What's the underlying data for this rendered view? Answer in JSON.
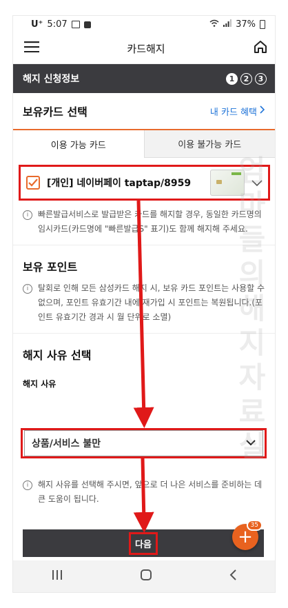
{
  "status_bar": {
    "carrier": "U⁺",
    "time": "5:07",
    "battery": "37%"
  },
  "app_bar": {
    "title": "카드해지"
  },
  "progress": {
    "title": "해지 신청정보",
    "steps": [
      "1",
      "2",
      "3"
    ],
    "current_step": 1
  },
  "card_section": {
    "title": "보유카드 선택",
    "benefit_link": "내 카드 혜택",
    "tabs": [
      "이용 가능 카드",
      "이용 불가능 카드"
    ],
    "selected_card": "[개인] 네이버페이 taptap/8959",
    "notice": "빠른발급서비스로 발급받은 카드를 해지할 경우, 동일한 카드명의 임시카드(카드명에 \"빠른발급S\" 표기)도 함께 해지해 주세요."
  },
  "points_section": {
    "title": "보유 포인트",
    "notice": "탈회로 인해 모든 삼성카드 해지 시, 보유 카드 포인트는 사용할 수 없으며, 포인트 유효기간 내에 재가입 시 포인트는 복원됩니다.(포인트 유효기간 경과 시 월 단위로 소멸)"
  },
  "reason_section": {
    "title": "해지 사유 선택",
    "field_label": "해지 사유",
    "selected_reason": "상품/서비스 불만",
    "notice": "해지 사유를 선택해 주시면, 앞으로 더 나은 서비스를 준비하는 데 큰 도움이 됩니다."
  },
  "next_button": {
    "label": "다음"
  },
  "fab": {
    "badge": "35"
  },
  "watermark": "엄마들의 해지자료실",
  "colors": {
    "accent": "#e86a2c",
    "dark": "#3b3b3f",
    "annotation_red": "#e01919",
    "link": "#1e73d8"
  }
}
